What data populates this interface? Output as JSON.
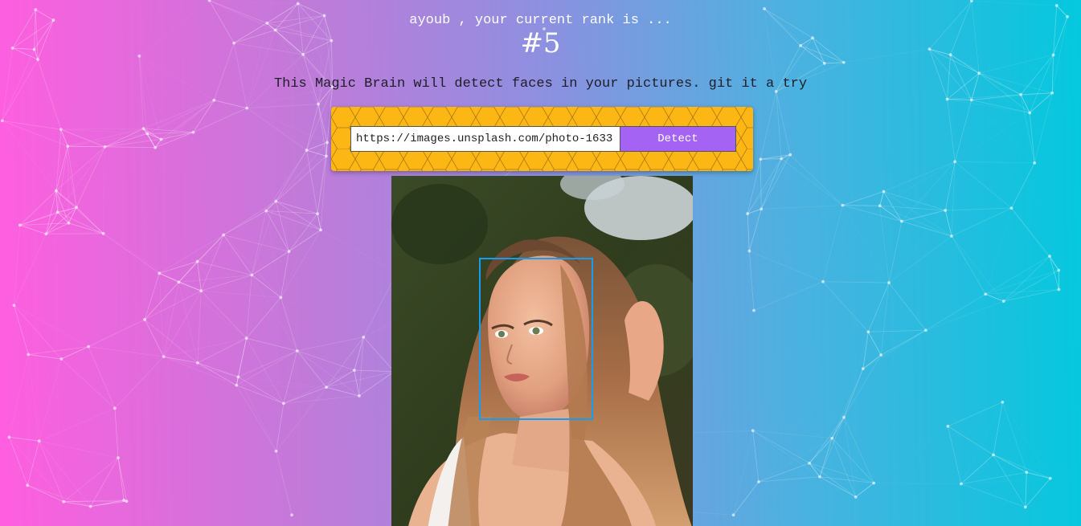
{
  "header": {
    "greeting": "ayoub , your current rank is ...",
    "rank": "#5"
  },
  "tagline": "This Magic Brain will detect faces in your pictures. git it a try",
  "form": {
    "url_value": "https://images.unsplash.com/photo-1633",
    "detect_label": "Detect"
  },
  "result": {
    "faces_detected": 1
  },
  "colors": {
    "gradient_left": "#ff5edf",
    "gradient_right": "#04c8de",
    "panel": "#fdb714",
    "button": "#a463f2",
    "face_box": "#149df2"
  }
}
